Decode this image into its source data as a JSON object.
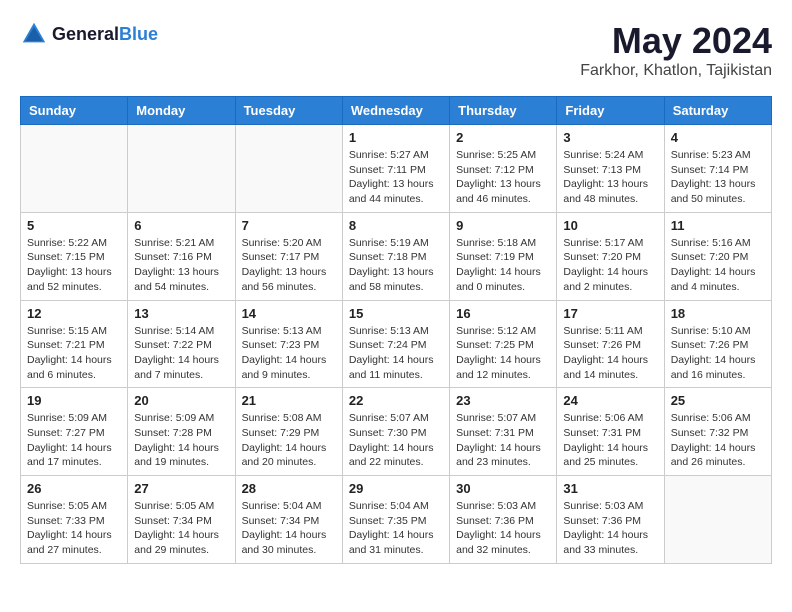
{
  "header": {
    "logo_line1": "General",
    "logo_line2": "Blue",
    "month": "May 2024",
    "location": "Farkhor, Khatlon, Tajikistan"
  },
  "weekdays": [
    "Sunday",
    "Monday",
    "Tuesday",
    "Wednesday",
    "Thursday",
    "Friday",
    "Saturday"
  ],
  "weeks": [
    [
      {
        "day": "",
        "info": ""
      },
      {
        "day": "",
        "info": ""
      },
      {
        "day": "",
        "info": ""
      },
      {
        "day": "1",
        "info": "Sunrise: 5:27 AM\nSunset: 7:11 PM\nDaylight: 13 hours\nand 44 minutes."
      },
      {
        "day": "2",
        "info": "Sunrise: 5:25 AM\nSunset: 7:12 PM\nDaylight: 13 hours\nand 46 minutes."
      },
      {
        "day": "3",
        "info": "Sunrise: 5:24 AM\nSunset: 7:13 PM\nDaylight: 13 hours\nand 48 minutes."
      },
      {
        "day": "4",
        "info": "Sunrise: 5:23 AM\nSunset: 7:14 PM\nDaylight: 13 hours\nand 50 minutes."
      }
    ],
    [
      {
        "day": "5",
        "info": "Sunrise: 5:22 AM\nSunset: 7:15 PM\nDaylight: 13 hours\nand 52 minutes."
      },
      {
        "day": "6",
        "info": "Sunrise: 5:21 AM\nSunset: 7:16 PM\nDaylight: 13 hours\nand 54 minutes."
      },
      {
        "day": "7",
        "info": "Sunrise: 5:20 AM\nSunset: 7:17 PM\nDaylight: 13 hours\nand 56 minutes."
      },
      {
        "day": "8",
        "info": "Sunrise: 5:19 AM\nSunset: 7:18 PM\nDaylight: 13 hours\nand 58 minutes."
      },
      {
        "day": "9",
        "info": "Sunrise: 5:18 AM\nSunset: 7:19 PM\nDaylight: 14 hours\nand 0 minutes."
      },
      {
        "day": "10",
        "info": "Sunrise: 5:17 AM\nSunset: 7:20 PM\nDaylight: 14 hours\nand 2 minutes."
      },
      {
        "day": "11",
        "info": "Sunrise: 5:16 AM\nSunset: 7:20 PM\nDaylight: 14 hours\nand 4 minutes."
      }
    ],
    [
      {
        "day": "12",
        "info": "Sunrise: 5:15 AM\nSunset: 7:21 PM\nDaylight: 14 hours\nand 6 minutes."
      },
      {
        "day": "13",
        "info": "Sunrise: 5:14 AM\nSunset: 7:22 PM\nDaylight: 14 hours\nand 7 minutes."
      },
      {
        "day": "14",
        "info": "Sunrise: 5:13 AM\nSunset: 7:23 PM\nDaylight: 14 hours\nand 9 minutes."
      },
      {
        "day": "15",
        "info": "Sunrise: 5:13 AM\nSunset: 7:24 PM\nDaylight: 14 hours\nand 11 minutes."
      },
      {
        "day": "16",
        "info": "Sunrise: 5:12 AM\nSunset: 7:25 PM\nDaylight: 14 hours\nand 12 minutes."
      },
      {
        "day": "17",
        "info": "Sunrise: 5:11 AM\nSunset: 7:26 PM\nDaylight: 14 hours\nand 14 minutes."
      },
      {
        "day": "18",
        "info": "Sunrise: 5:10 AM\nSunset: 7:26 PM\nDaylight: 14 hours\nand 16 minutes."
      }
    ],
    [
      {
        "day": "19",
        "info": "Sunrise: 5:09 AM\nSunset: 7:27 PM\nDaylight: 14 hours\nand 17 minutes."
      },
      {
        "day": "20",
        "info": "Sunrise: 5:09 AM\nSunset: 7:28 PM\nDaylight: 14 hours\nand 19 minutes."
      },
      {
        "day": "21",
        "info": "Sunrise: 5:08 AM\nSunset: 7:29 PM\nDaylight: 14 hours\nand 20 minutes."
      },
      {
        "day": "22",
        "info": "Sunrise: 5:07 AM\nSunset: 7:30 PM\nDaylight: 14 hours\nand 22 minutes."
      },
      {
        "day": "23",
        "info": "Sunrise: 5:07 AM\nSunset: 7:31 PM\nDaylight: 14 hours\nand 23 minutes."
      },
      {
        "day": "24",
        "info": "Sunrise: 5:06 AM\nSunset: 7:31 PM\nDaylight: 14 hours\nand 25 minutes."
      },
      {
        "day": "25",
        "info": "Sunrise: 5:06 AM\nSunset: 7:32 PM\nDaylight: 14 hours\nand 26 minutes."
      }
    ],
    [
      {
        "day": "26",
        "info": "Sunrise: 5:05 AM\nSunset: 7:33 PM\nDaylight: 14 hours\nand 27 minutes."
      },
      {
        "day": "27",
        "info": "Sunrise: 5:05 AM\nSunset: 7:34 PM\nDaylight: 14 hours\nand 29 minutes."
      },
      {
        "day": "28",
        "info": "Sunrise: 5:04 AM\nSunset: 7:34 PM\nDaylight: 14 hours\nand 30 minutes."
      },
      {
        "day": "29",
        "info": "Sunrise: 5:04 AM\nSunset: 7:35 PM\nDaylight: 14 hours\nand 31 minutes."
      },
      {
        "day": "30",
        "info": "Sunrise: 5:03 AM\nSunset: 7:36 PM\nDaylight: 14 hours\nand 32 minutes."
      },
      {
        "day": "31",
        "info": "Sunrise: 5:03 AM\nSunset: 7:36 PM\nDaylight: 14 hours\nand 33 minutes."
      },
      {
        "day": "",
        "info": ""
      }
    ]
  ]
}
